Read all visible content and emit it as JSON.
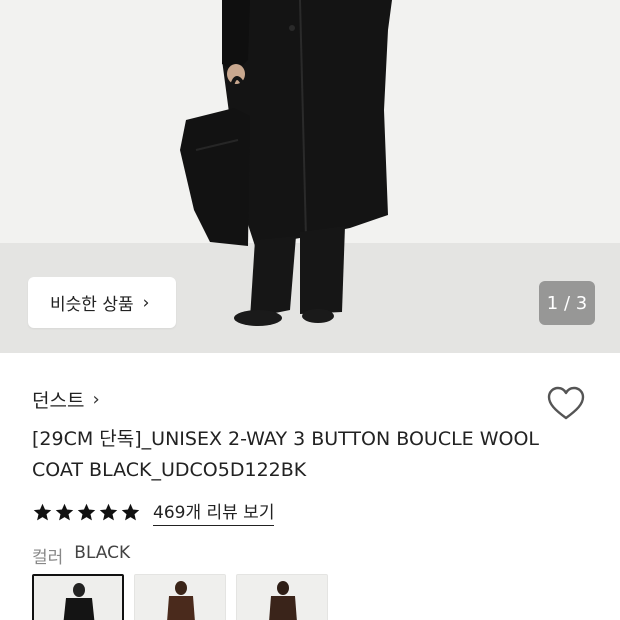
{
  "gallery": {
    "similar_button_label": "비슷한 상품",
    "counter": "1 / 3"
  },
  "product": {
    "brand": "던스트",
    "title": "[29CM 단독]_UNISEX 2-WAY 3 BUTTON BOUCLE WOOL COAT BLACK_UDCO5D122BK",
    "rating_stars": 5,
    "review_link": "469개 리뷰 보기",
    "color_label": "컬러",
    "color_value": "BLACK",
    "swatches": [
      {
        "name": "black",
        "selected": true
      },
      {
        "name": "brown",
        "selected": false
      },
      {
        "name": "dark-brown",
        "selected": false
      }
    ]
  },
  "colors": {
    "coat_black": "#141414",
    "swatch_brown": "#4a2a1c"
  }
}
